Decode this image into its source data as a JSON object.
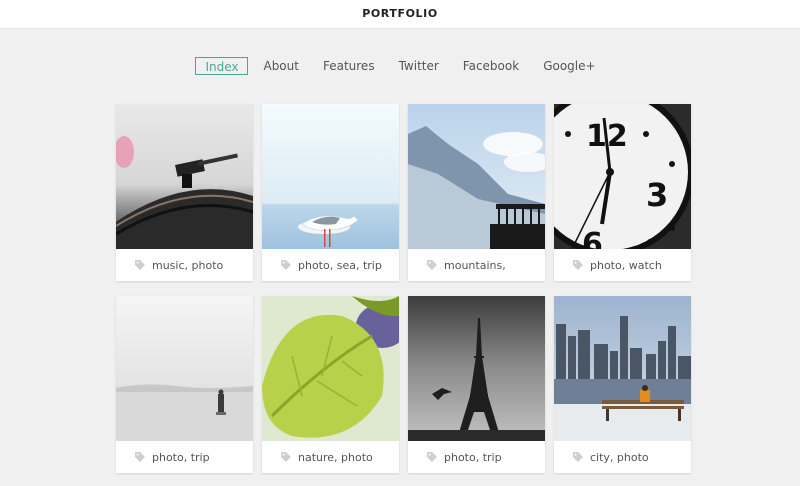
{
  "header": {
    "title": "PORTFOLIO"
  },
  "nav": {
    "items": [
      {
        "label": "Index",
        "active": true
      },
      {
        "label": "About"
      },
      {
        "label": "Features"
      },
      {
        "label": "Twitter"
      },
      {
        "label": "Facebook"
      },
      {
        "label": "Google+"
      }
    ]
  },
  "colors": {
    "accent": "#4aa88f",
    "background": "#f0f0f0",
    "card": "#ffffff"
  },
  "portfolio": {
    "items": [
      {
        "tags": "music, photo",
        "image": "turntable"
      },
      {
        "tags": "photo, sea, trip",
        "image": "seagull"
      },
      {
        "tags": "mountains,",
        "image": "mountains-pier"
      },
      {
        "tags": "photo, watch",
        "image": "clock"
      },
      {
        "tags": "photo, trip",
        "image": "foggy-sea"
      },
      {
        "tags": "nature, photo",
        "image": "leaves"
      },
      {
        "tags": "photo, trip",
        "image": "eiffel-tower"
      },
      {
        "tags": "city, photo",
        "image": "city-skyline"
      }
    ]
  }
}
